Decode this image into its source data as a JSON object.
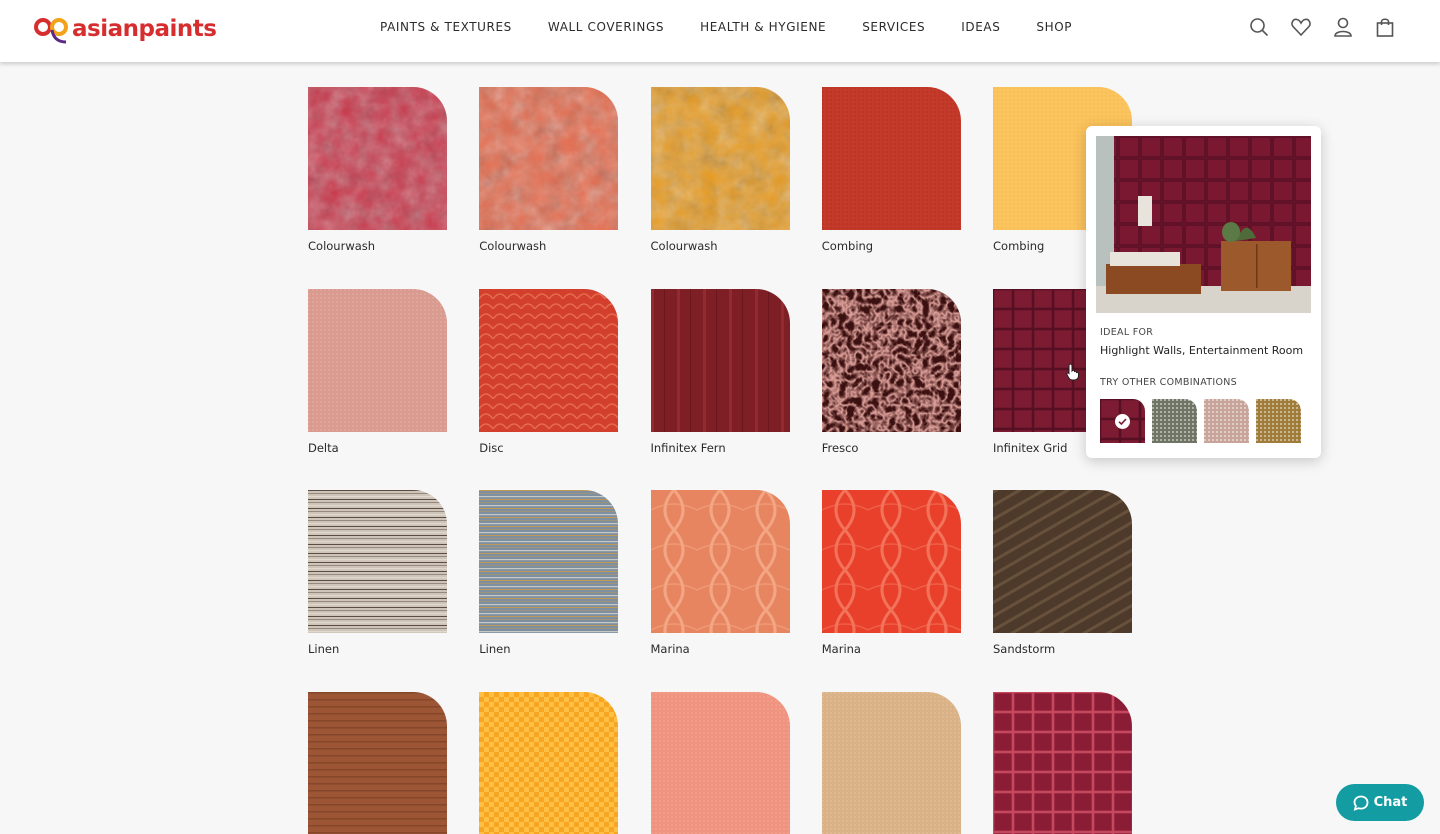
{
  "header": {
    "logo_text": "asianpaints",
    "nav": [
      "PAINTS & TEXTURES",
      "WALL COVERINGS",
      "HEALTH & HYGIENE",
      "SERVICES",
      "IDEAS",
      "SHOP"
    ],
    "icons": [
      "search-icon",
      "wishlist-heart-icon",
      "user-account-icon",
      "shopping-bag-icon"
    ]
  },
  "textures": [
    {
      "label": "Colourwash",
      "pattern": "mottle",
      "base": "#c9374a",
      "accent": "#e0707a"
    },
    {
      "label": "Colourwash",
      "pattern": "mottle",
      "base": "#e56a4c",
      "accent": "#f29a78"
    },
    {
      "label": "Colourwash",
      "pattern": "mottle",
      "base": "#e89a1e",
      "accent": "#f7c94a"
    },
    {
      "label": "Combing",
      "pattern": "fine",
      "base": "#c43a2a",
      "accent": "#b02e22"
    },
    {
      "label": "Combing",
      "pattern": "fine",
      "base": "#fbc45e",
      "accent": "#f4b94c"
    },
    {
      "label": "Delta",
      "pattern": "fine",
      "base": "#d99a90",
      "accent": "#e8b2a8"
    },
    {
      "label": "Disc",
      "pattern": "scale",
      "base": "#d23f2d",
      "accent": "#e66a4d"
    },
    {
      "label": "Infinitex Fern",
      "pattern": "vstripe",
      "base": "#7e1f26",
      "accent": "#932a30"
    },
    {
      "label": "Fresco",
      "pattern": "speckle",
      "base": "#3b1010",
      "accent": "#b85a52"
    },
    {
      "label": "Infinitex Grid",
      "pattern": "grid",
      "base": "#7c1b32",
      "accent": "#571023"
    },
    {
      "label": "Linen",
      "pattern": "hstripe",
      "base": "#cfc4b8",
      "accent": "#5b4c44"
    },
    {
      "label": "Linen",
      "pattern": "hstripe",
      "base": "#7d8fa0",
      "accent": "#c09a55"
    },
    {
      "label": "Marina",
      "pattern": "marble",
      "base": "#e78560",
      "accent": "#f3a684"
    },
    {
      "label": "Marina",
      "pattern": "marble",
      "base": "#e8402b",
      "accent": "#f3735a"
    },
    {
      "label": "Sandstorm",
      "pattern": "diag",
      "base": "#4e3a2a",
      "accent": "#7a6048"
    },
    {
      "label": "",
      "pattern": "wood",
      "base": "#9c5636",
      "accent": "#7c3f25"
    },
    {
      "label": "",
      "pattern": "weave",
      "base": "#f6a620",
      "accent": "#ffbf45"
    },
    {
      "label": "",
      "pattern": "fine",
      "base": "#ef9480",
      "accent": "#f5a896"
    },
    {
      "label": "",
      "pattern": "fine",
      "base": "#d9b288",
      "accent": "#e4c29c"
    },
    {
      "label": "",
      "pattern": "grid",
      "base": "#8a1c35",
      "accent": "#c6485e"
    }
  ],
  "popover": {
    "ideal_for_label": "IDEAL FOR",
    "ideal_for_value": "Highlight Walls, Entertainment Room",
    "combinations_label": "TRY OTHER COMBINATIONS",
    "combinations": [
      {
        "color": "#7c1b32",
        "selected": true
      },
      {
        "color": "#6f7464",
        "selected": false
      },
      {
        "color": "#c9a49a",
        "selected": false
      },
      {
        "color": "#a07c3a",
        "selected": false
      }
    ]
  },
  "chat": {
    "label": "Chat"
  }
}
